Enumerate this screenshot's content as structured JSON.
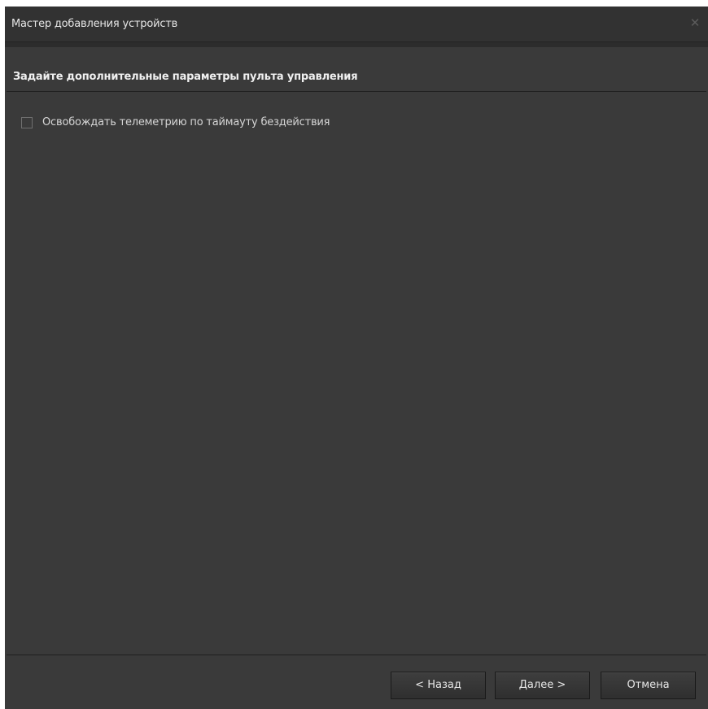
{
  "window": {
    "title": "Мастер добавления устройств",
    "close_icon": "close-icon"
  },
  "header": {
    "title": "Задайте дополнительные параметры пульта управления"
  },
  "options": [
    {
      "label": "Освобождать телеметрию по таймауту бездействия",
      "checked": false
    }
  ],
  "footer": {
    "back_label": "< Назад",
    "next_label": "Далее >",
    "cancel_label": "Отмена"
  },
  "colors": {
    "background": "#3a3a3a",
    "titlebar": "#323232",
    "text": "#e6e6e6"
  }
}
